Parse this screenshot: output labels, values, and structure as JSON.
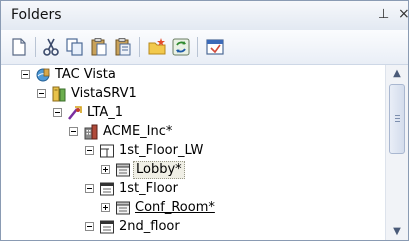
{
  "panel": {
    "title": "Folders",
    "pin_glyph": "⊥",
    "close_glyph": "×"
  },
  "toolbar": {
    "buttons": [
      {
        "name": "new-document-icon"
      },
      {
        "name": "cut-icon"
      },
      {
        "name": "copy-icon"
      },
      {
        "name": "paste-icon"
      },
      {
        "name": "paste-special-icon"
      },
      {
        "name": "new-folder-icon"
      },
      {
        "name": "refresh-icon"
      },
      {
        "name": "properties-icon"
      }
    ]
  },
  "tree": {
    "items": [
      {
        "label": "TAC Vista",
        "icon": "server-network-icon",
        "expanded": true
      },
      {
        "label": "VistaSRV1",
        "icon": "database-server-icon",
        "expanded": true
      },
      {
        "label": "LTA_1",
        "icon": "network-adapter-icon",
        "expanded": true
      },
      {
        "label": "ACME_Inc*",
        "icon": "building-icon",
        "expanded": true
      },
      {
        "label": "1st_Floor_LW",
        "icon": "floor-lw-icon",
        "expanded": true
      },
      {
        "label": "Lobby*",
        "icon": "room-icon",
        "expanded": false,
        "selected": true
      },
      {
        "label": "1st_Floor",
        "icon": "floor-icon",
        "expanded": true
      },
      {
        "label": "Conf_Room*",
        "icon": "room-icon",
        "expanded": false,
        "underlined": true
      },
      {
        "label": "2nd_floor",
        "icon": "floor-icon",
        "expanded": true
      }
    ]
  },
  "scrollbar": {
    "up_glyph": "▲",
    "down_glyph": "▼"
  }
}
